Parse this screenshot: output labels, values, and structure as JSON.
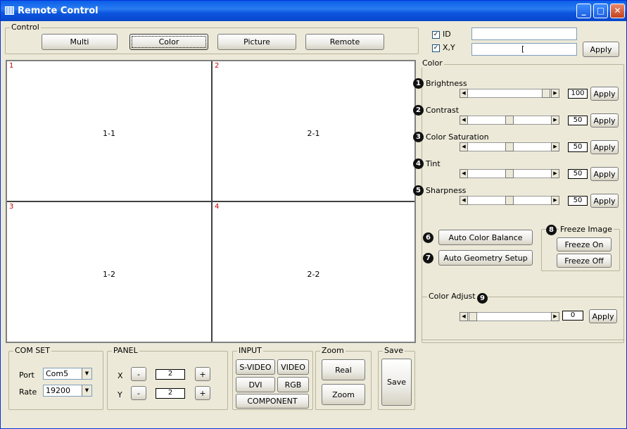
{
  "window": {
    "title": "Remote Control"
  },
  "control": {
    "label": "Control",
    "tabs": [
      "Multi",
      "Color",
      "Picture",
      "Remote"
    ]
  },
  "id_panel": {
    "id_label": "ID",
    "xy_label": "X,Y",
    "id_checked": true,
    "xy_checked": true,
    "id_value": "",
    "xy_value": "[",
    "apply_label": "Apply"
  },
  "grid": {
    "cells": [
      {
        "num": "1",
        "label": "1-1"
      },
      {
        "num": "2",
        "label": "2-1"
      },
      {
        "num": "3",
        "label": "1-2"
      },
      {
        "num": "4",
        "label": "2-2"
      }
    ]
  },
  "color": {
    "label": "Color",
    "sliders": [
      {
        "badge": "1",
        "label": "Brightness",
        "value": "100",
        "level": 1.0,
        "apply": "Apply"
      },
      {
        "badge": "2",
        "label": "Contrast",
        "value": "50",
        "level": 0.5,
        "apply": "Apply"
      },
      {
        "badge": "3",
        "label": "Color Saturation",
        "value": "50",
        "level": 0.5,
        "apply": "Apply"
      },
      {
        "badge": "4",
        "label": "Tint",
        "value": "50",
        "level": 0.5,
        "apply": "Apply"
      },
      {
        "badge": "5",
        "label": "Sharpness",
        "value": "50",
        "level": 0.5,
        "apply": "Apply"
      }
    ],
    "auto_color": {
      "badge": "6",
      "label": "Auto Color Balance"
    },
    "auto_geometry": {
      "badge": "7",
      "label": "Auto Geometry Setup"
    },
    "freeze": {
      "badge": "8",
      "label": "Freeze Image",
      "on": "Freeze On",
      "off": "Freeze Off"
    },
    "adjust": {
      "badge": "9",
      "label": "Color Adjust",
      "value": "0",
      "level": 0.0,
      "apply": "Apply"
    }
  },
  "comset": {
    "label": "COM SET",
    "port_label": "Port",
    "port_value": "Com5",
    "rate_label": "Rate",
    "rate_value": "19200"
  },
  "panel": {
    "label": "PANEL",
    "x_label": "X",
    "y_label": "Y",
    "x_value": "2",
    "y_value": "2",
    "minus": "-",
    "plus": "+"
  },
  "input": {
    "label": "INPUT",
    "svideo": "S-VIDEO",
    "video": "VIDEO",
    "dvi": "DVI",
    "rgb": "RGB",
    "component": "COMPONENT"
  },
  "zoom": {
    "label": "Zoom",
    "real": "Real",
    "zoom": "Zoom"
  },
  "save": {
    "label": "Save",
    "button": "Save"
  },
  "icons": {
    "min": "minimize-icon",
    "max": "maximize-icon",
    "close": "close-icon",
    "left": "arrow-left-icon",
    "right": "arrow-right-icon",
    "dropdown": "chevron-down-icon"
  }
}
